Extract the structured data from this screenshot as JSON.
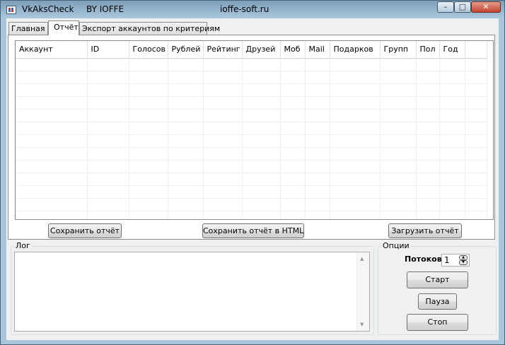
{
  "window": {
    "title": "VkAksCheck",
    "author": "BY IOFFE",
    "site": "ioffe-soft.ru",
    "controls": {
      "minimize": "–",
      "maximize": "□",
      "close": "✕"
    }
  },
  "tabs": [
    {
      "label": "Главная"
    },
    {
      "label": "Отчёт"
    },
    {
      "label": "Экспорт аккаунтов по критериям"
    }
  ],
  "report": {
    "columns": [
      "Аккаунт",
      "ID",
      "Голосов",
      "Рублей",
      "Рейтинг",
      "Друзей",
      "Моб",
      "Mail",
      "Подарков",
      "Групп",
      "Пол",
      "Год"
    ],
    "rows": []
  },
  "buttons": {
    "save_report": "Сохранить отчёт",
    "save_html": "Сохранить отчёт в HTML",
    "load_report": "Загрузить отчёт"
  },
  "log": {
    "label": "Лог",
    "text": "",
    "scroll_up": "▲",
    "scroll_down": "▼"
  },
  "options": {
    "label": "Опции",
    "threads_label": "Потоков",
    "threads_value": "1",
    "spin_up": "▲",
    "spin_down": "▼",
    "start": "Старт",
    "pause": "Пауза",
    "stop": "Стоп"
  }
}
